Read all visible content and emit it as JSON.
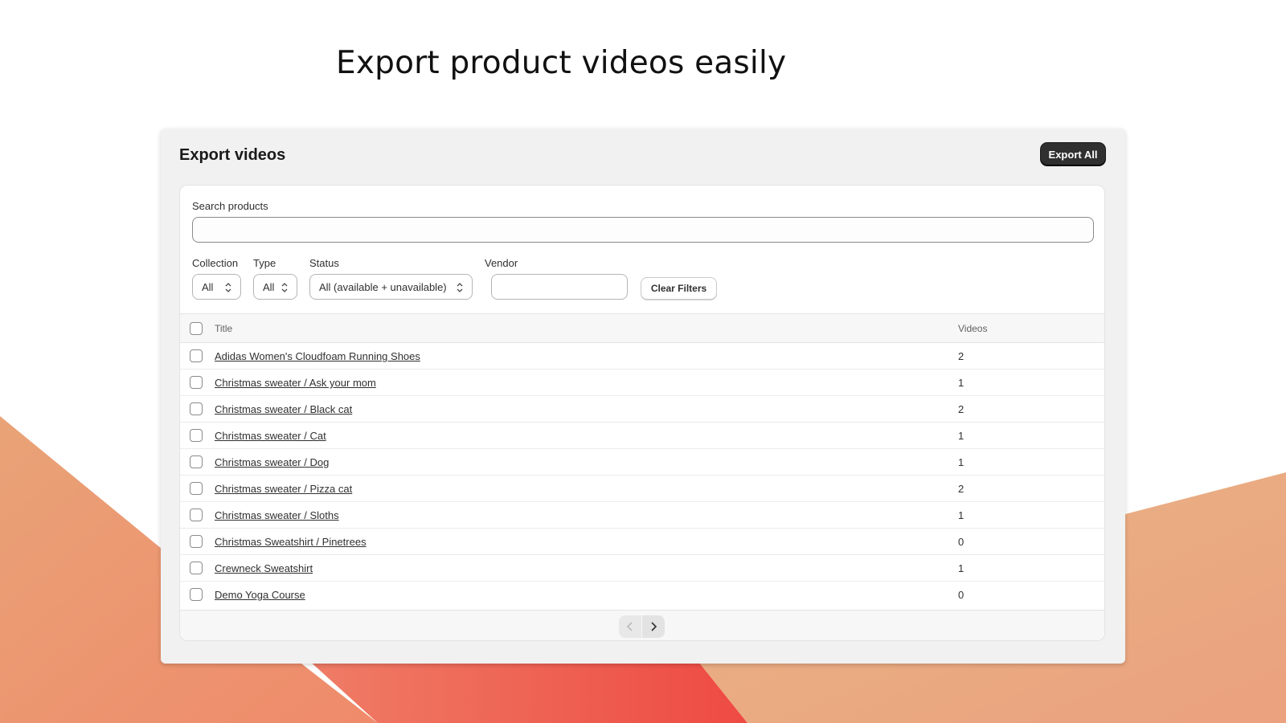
{
  "headline": "Export product videos easily",
  "colors": {
    "background_orange": "#ec9a72",
    "background_red": "#ef4a45",
    "background_peach": "#e8b586",
    "primary_button": "#303030"
  },
  "card": {
    "title": "Export videos",
    "export_all_label": "Export All"
  },
  "search": {
    "label": "Search products",
    "value": "",
    "placeholder": ""
  },
  "filters": {
    "collection": {
      "label": "Collection",
      "value": "All"
    },
    "type": {
      "label": "Type",
      "value": "All"
    },
    "status": {
      "label": "Status",
      "value": "All (available + unavailable)"
    },
    "vendor": {
      "label": "Vendor",
      "value": ""
    },
    "clear_label": "Clear Filters"
  },
  "table": {
    "columns": [
      "Title",
      "Videos"
    ],
    "rows": [
      {
        "title": "Adidas Women's Cloudfoam Running Shoes",
        "videos": "2"
      },
      {
        "title": "Christmas sweater / Ask your mom",
        "videos": "1"
      },
      {
        "title": "Christmas sweater / Black cat",
        "videos": "2"
      },
      {
        "title": "Christmas sweater / Cat",
        "videos": "1"
      },
      {
        "title": "Christmas sweater / Dog",
        "videos": "1"
      },
      {
        "title": "Christmas sweater / Pizza cat",
        "videos": "2"
      },
      {
        "title": "Christmas sweater / Sloths",
        "videos": "1"
      },
      {
        "title": "Christmas Sweatshirt / Pinetrees",
        "videos": "0"
      },
      {
        "title": "Crewneck Sweatshirt",
        "videos": "1"
      },
      {
        "title": "Demo Yoga Course",
        "videos": "0"
      }
    ]
  },
  "pagination": {
    "prev_icon": "chevron-left-icon",
    "next_icon": "chevron-right-icon"
  }
}
